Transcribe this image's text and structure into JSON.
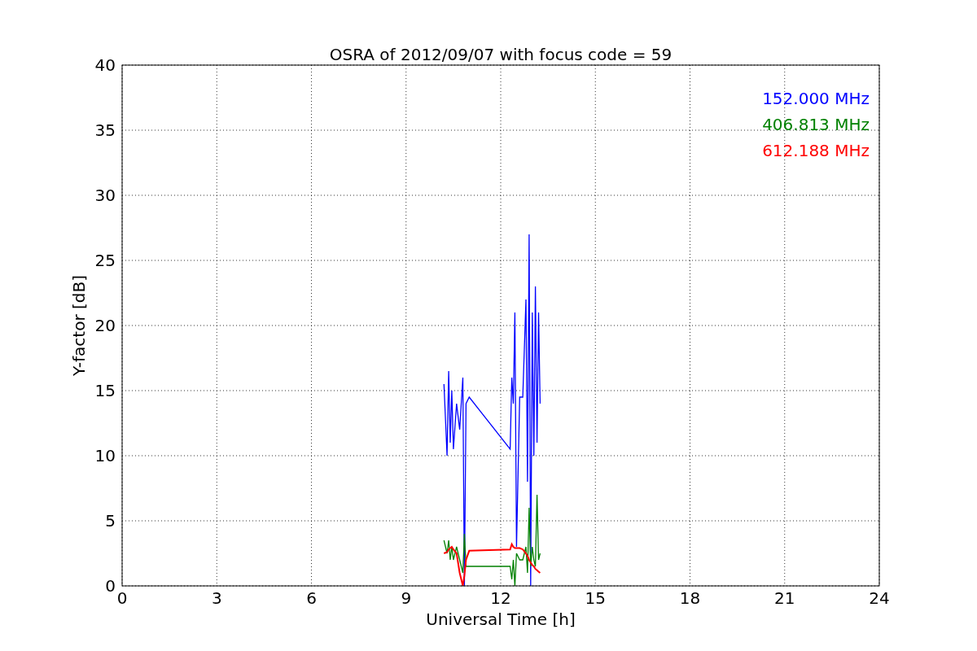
{
  "figure": {
    "chart_data": {
      "type": "line",
      "title": "OSRA of 2012/09/07 with focus code = 59",
      "xlabel": "Universal Time [h]",
      "ylabel": "Y-factor [dB]",
      "x": [
        10.2,
        10.3,
        10.35,
        10.4,
        10.45,
        10.5,
        10.6,
        10.7,
        10.8,
        10.85,
        10.9,
        11.0,
        12.3,
        12.35,
        12.4,
        12.45,
        12.5,
        12.6,
        12.7,
        12.8,
        12.85,
        12.9,
        12.95,
        13.0,
        13.05,
        13.1,
        13.15,
        13.2,
        13.25
      ],
      "series": [
        {
          "name": "152.000 MHz",
          "color": "#0000ff",
          "values": [
            15.5,
            10,
            16.5,
            11,
            15,
            10.5,
            14,
            12,
            16,
            0,
            14,
            14.5,
            10.5,
            16,
            14,
            21,
            3,
            14.5,
            14.5,
            22,
            8,
            27,
            0,
            21,
            10,
            23,
            11,
            21,
            14
          ]
        },
        {
          "name": "406.813 MHz",
          "color": "#008000",
          "values": [
            3.5,
            2.5,
            3.5,
            2,
            3,
            2,
            3,
            2,
            1,
            4,
            1.5,
            1.5,
            1.5,
            0.5,
            2,
            0,
            2.5,
            2,
            2,
            3,
            1,
            6,
            1.5,
            3,
            2,
            1.5,
            7,
            2,
            2.5
          ]
        },
        {
          "name": "612.188 MHz",
          "color": "#ff0000",
          "values": [
            2.5,
            2.6,
            2.8,
            2.9,
            3,
            2.8,
            2.5,
            1,
            0,
            0.8,
            2,
            2.7,
            2.8,
            3.2,
            3,
            2.9,
            2.9,
            2.9,
            2.8,
            2.5,
            2.3,
            2,
            1.8,
            1.6,
            1.5,
            1.3,
            1.2,
            1.1,
            1.0
          ]
        }
      ],
      "xlim": [
        0,
        24
      ],
      "ylim": [
        0,
        40
      ],
      "xticks": [
        0,
        3,
        6,
        9,
        12,
        15,
        18,
        21,
        24
      ],
      "yticks": [
        0,
        5,
        10,
        15,
        20,
        25,
        30,
        35,
        40
      ],
      "grid": true
    }
  }
}
